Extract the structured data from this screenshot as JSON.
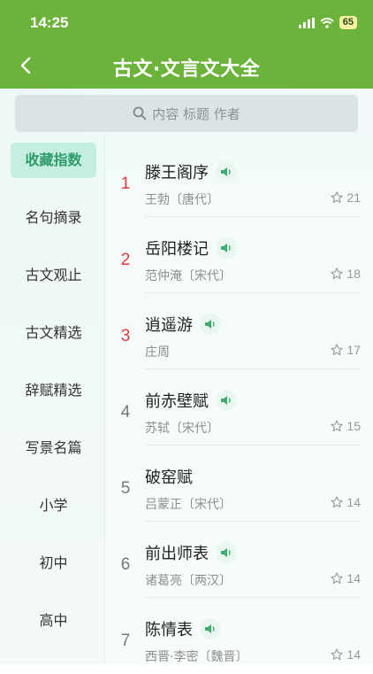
{
  "status": {
    "time": "14:25",
    "battery": "65"
  },
  "header": {
    "title": "古文·文言文大全"
  },
  "search": {
    "placeholder": "内容 标题 作者"
  },
  "sidebar": {
    "items": [
      {
        "label": "收藏指数",
        "active": true
      },
      {
        "label": "名句摘录"
      },
      {
        "label": "古文观止"
      },
      {
        "label": "古文精选"
      },
      {
        "label": "辞赋精选"
      },
      {
        "label": "写景名篇"
      },
      {
        "label": "小学"
      },
      {
        "label": "初中"
      },
      {
        "label": "高中"
      }
    ]
  },
  "list": {
    "items": [
      {
        "rank": "1",
        "title": "滕王阁序",
        "author": "王勃〔唐代〕",
        "favorites": "21",
        "audio": true
      },
      {
        "rank": "2",
        "title": "岳阳楼记",
        "author": "范仲淹〔宋代〕",
        "favorites": "18",
        "audio": true
      },
      {
        "rank": "3",
        "title": "逍遥游",
        "author": "庄周",
        "favorites": "17",
        "audio": true
      },
      {
        "rank": "4",
        "title": "前赤壁赋",
        "author": "苏轼〔宋代〕",
        "favorites": "15",
        "audio": true
      },
      {
        "rank": "5",
        "title": "破窑赋",
        "author": "吕蒙正〔宋代〕",
        "favorites": "14",
        "audio": false
      },
      {
        "rank": "6",
        "title": "前出师表",
        "author": "诸葛亮〔两汉〕",
        "favorites": "14",
        "audio": true
      },
      {
        "rank": "7",
        "title": "陈情表",
        "author": "西晋·李密〔魏晋〕",
        "favorites": "14",
        "audio": true
      }
    ]
  },
  "colors": {
    "header": "#6cb33b",
    "accent": "#2f9a6a",
    "rank_top": "#e0393e"
  },
  "icons": {
    "back": "chevron-left-icon",
    "search": "search-icon",
    "audio": "speaker-icon",
    "favorite": "star-icon"
  }
}
